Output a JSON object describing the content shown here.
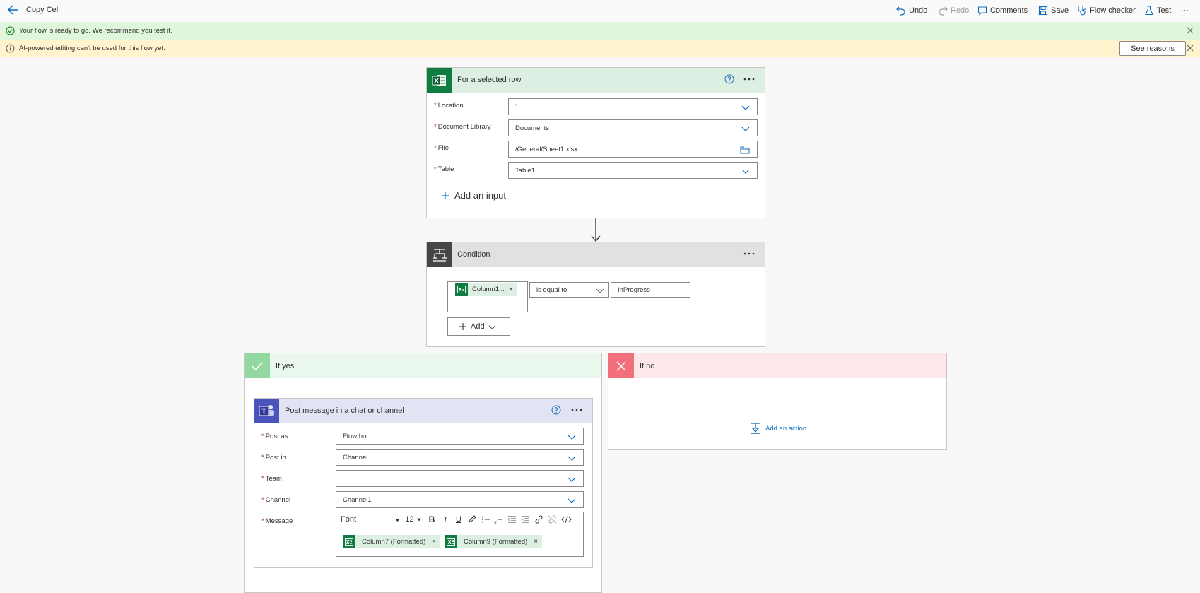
{
  "app": {
    "title": "Copy Cell"
  },
  "toolbar": {
    "undo": "Undo",
    "redo": "Redo",
    "comments": "Comments",
    "save": "Save",
    "flow_checker": "Flow checker",
    "test": "Test",
    "more": "···"
  },
  "banners": {
    "ready": "Your flow is ready to go. We recommend you test it.",
    "ai_warning": "AI-powered editing can't be used for this flow yet.",
    "see_reasons": "See reasons"
  },
  "trigger": {
    "title": "For a selected row",
    "fields": [
      {
        "label": "Location",
        "value": "'"
      },
      {
        "label": "Document Library",
        "value": "Documents"
      },
      {
        "label": "File",
        "value": "/General/Sheet1.xlsx"
      },
      {
        "label": "Table",
        "value": "Table1"
      }
    ],
    "add_input": "Add an input"
  },
  "condition": {
    "title": "Condition",
    "token": "Column1...",
    "token_remove": "×",
    "operator": "is equal to",
    "value": "InProgress",
    "add": "Add"
  },
  "if_yes": {
    "label": "If yes"
  },
  "if_no": {
    "label": "If no",
    "add_action": "Add an action"
  },
  "teams_action": {
    "title": "Post message in a chat or channel",
    "fields": [
      {
        "label": "Post as",
        "value": "Flow bot"
      },
      {
        "label": "Post in",
        "value": "Channel"
      },
      {
        "label": "Team",
        "value": ""
      },
      {
        "label": "Channel",
        "value": "Channel1"
      }
    ],
    "message_label": "Message",
    "editor": {
      "font": "Font",
      "size": "12"
    },
    "tokens": [
      "Column7 (Formatted)",
      "Column9 (Formatted)"
    ],
    "token_remove": "×"
  },
  "colors": {
    "excel_green": "#107c41",
    "teams_purple": "#4b53bc",
    "condition_gray": "#484644",
    "success_banner": "#dff6dd",
    "warning_banner": "#fff4ce",
    "link_blue": "#0f6cbd",
    "required_red": "#a4262c"
  }
}
